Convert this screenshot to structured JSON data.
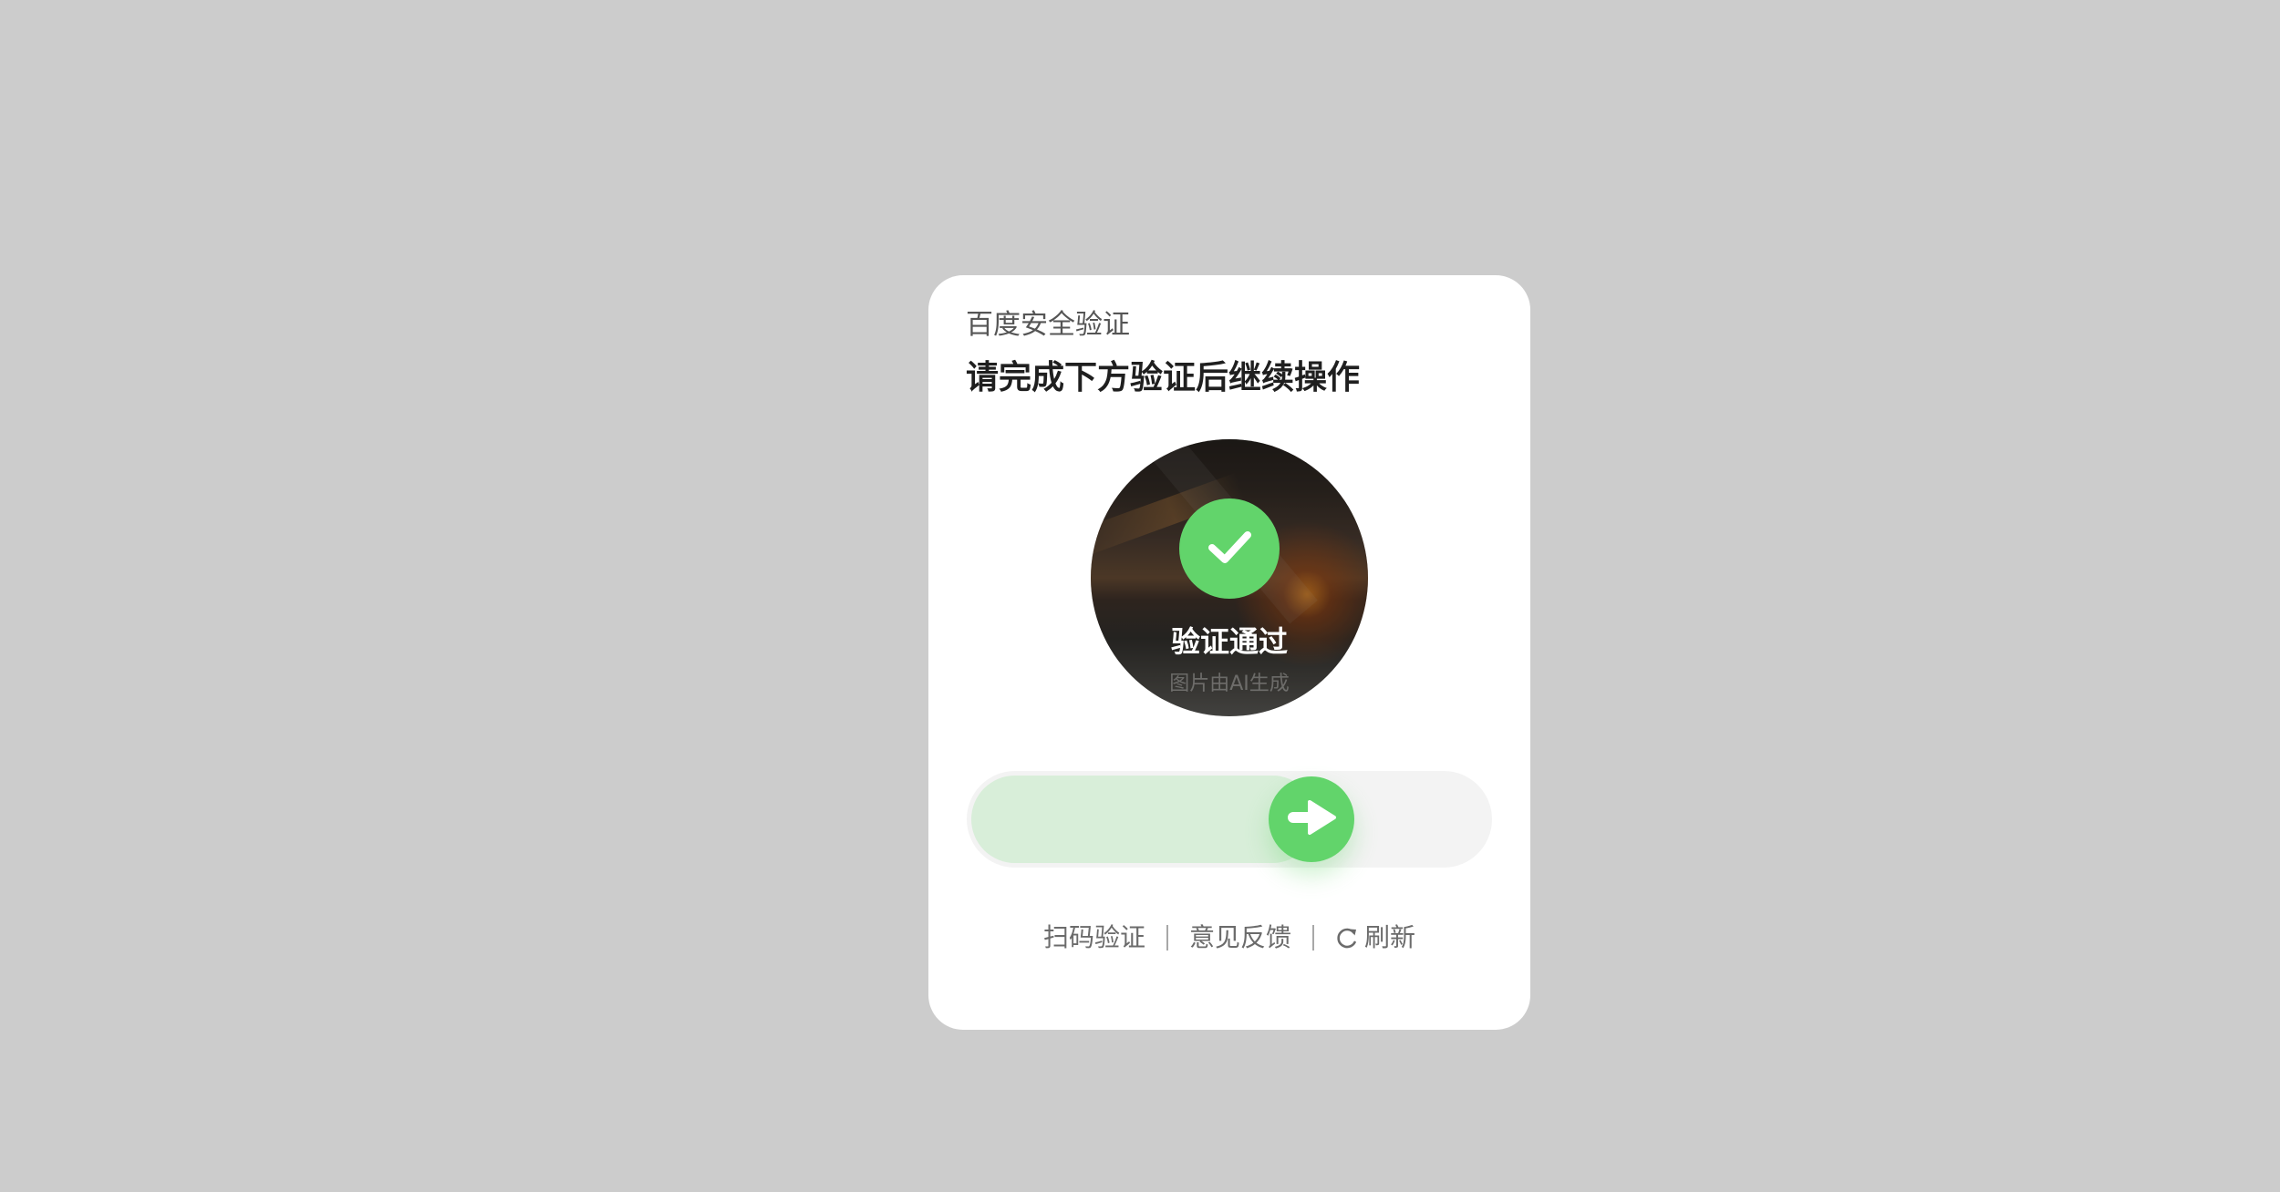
{
  "header": {
    "brand": "百度安全验证",
    "title": "请完成下方验证后继续操作"
  },
  "puzzle": {
    "status_text": "验证通过",
    "ai_note": "图片由AI生成",
    "status_icon": "check-icon",
    "status_color": "#62d46b"
  },
  "slider": {
    "progress": 0.69,
    "knob_icon": "arrow-right-icon",
    "accent": "#62d46b",
    "fill_color": "#d8eed9",
    "track_color": "#f3f3f3"
  },
  "footer": {
    "scan_label": "扫码验证",
    "feedback_label": "意见反馈",
    "refresh_label": "刷新",
    "refresh_icon": "refresh-icon"
  },
  "colors": {
    "page_background": "#cccccc",
    "card_background": "#ffffff"
  }
}
